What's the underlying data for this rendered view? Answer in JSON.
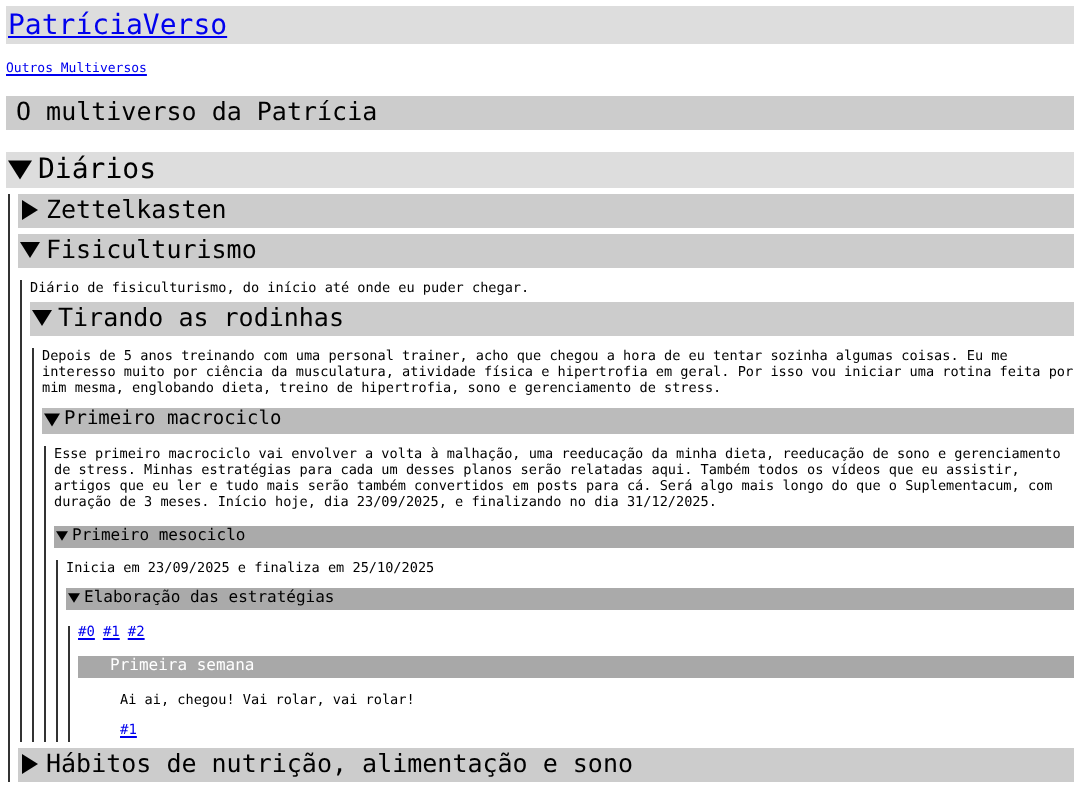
{
  "site_title": "PatríciaVerso",
  "nav_link": "Outros Multiversos",
  "heading": "O multiverso da Patrícia",
  "sections": [
    {
      "kind": "section",
      "title": "Diários",
      "expanded": true,
      "children": [
        {
          "kind": "section",
          "title": "Zettelkasten",
          "expanded": false
        },
        {
          "kind": "section",
          "title": "Fisiculturismo",
          "expanded": true,
          "text": "Diário de fisiculturismo, do início até onde eu puder chegar.",
          "children": [
            {
              "kind": "section",
              "title": "Tirando as rodinhas",
              "expanded": true,
              "text": "Depois de 5 anos treinando com uma personal trainer, acho que chegou a hora de eu tentar sozinha algumas coisas. Eu me interesso muito por ciência da musculatura, atividade física e hipertrofia em geral. Por isso vou iniciar uma rotina feita por mim mesma, englobando dieta, treino de hipertrofia, sono e gerenciamento de stress.",
              "children": [
                {
                  "kind": "section",
                  "title": "Primeiro macrociclo",
                  "expanded": true,
                  "text": "Esse primeiro macrociclo vai envolver a volta à malhação, uma reeducação da minha dieta, reeducação de sono e gerenciamento de stress. Minhas estratégias para cada um desses planos serão relatadas aqui. Também todos os vídeos que eu assistir, artigos que eu ler e tudo mais serão também convertidos em posts para cá. Será algo mais longo do que o Suplementacum, com duração de 3 meses. Início hoje, dia 23/09/2025, e finalizando no dia 31/12/2025.",
                  "children": [
                    {
                      "kind": "section",
                      "title": "Primeiro mesociclo",
                      "expanded": true,
                      "text": "Inicia em 23/09/2025 e finaliza em 25/10/2025",
                      "children": [
                        {
                          "kind": "section",
                          "title": "Elaboração das estratégias",
                          "expanded": true,
                          "links": [
                            "#0",
                            "#1",
                            "#2"
                          ],
                          "children": [
                            {
                              "kind": "entry",
                              "title": "Primeira semana",
                              "text": "Ai ai, chegou! Vai rolar, vai rolar!",
                              "links": [
                                "#1"
                              ]
                            }
                          ]
                        }
                      ]
                    }
                  ]
                }
              ]
            }
          ]
        },
        {
          "kind": "section",
          "title": "Hábitos de nutrição, alimentação e sono",
          "expanded": false
        }
      ]
    }
  ]
}
